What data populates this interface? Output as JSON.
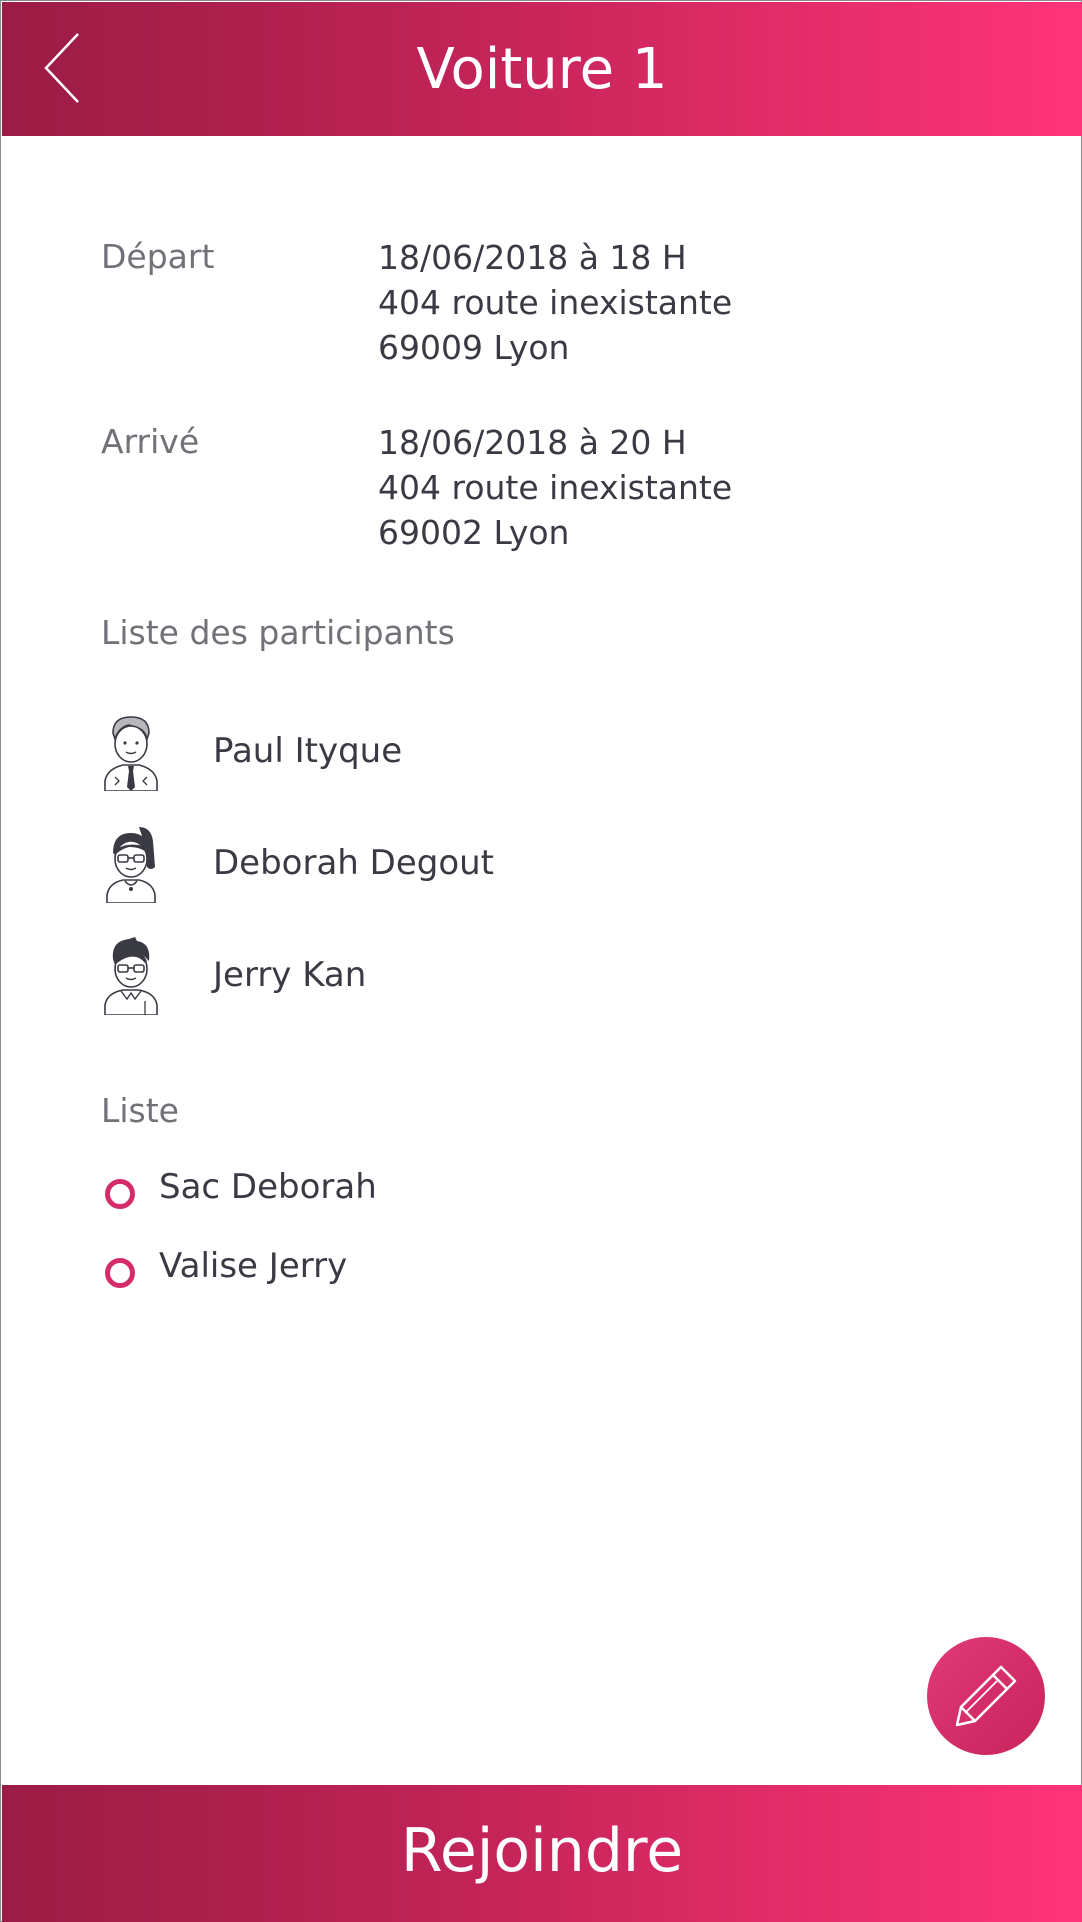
{
  "header": {
    "title": "Voiture 1"
  },
  "trip": {
    "departure": {
      "label": "Départ",
      "datetime": "18/06/2018 à 18 H",
      "street": "404 route inexistante",
      "city": "69009 Lyon"
    },
    "arrival": {
      "label": "Arrivé",
      "datetime": "18/06/2018 à 20 H",
      "street": "404 route inexistante",
      "city": "69002 Lyon"
    }
  },
  "participants": {
    "title": "Liste des participants",
    "items": [
      {
        "name": "Paul Ityque",
        "avatar": "man-tie-avatar-icon"
      },
      {
        "name": "Deborah Degout",
        "avatar": "woman-glasses-avatar-icon"
      },
      {
        "name": "Jerry Kan",
        "avatar": "man-glasses-avatar-icon"
      }
    ]
  },
  "luggage": {
    "title": "Liste",
    "items": [
      {
        "label": "Sac Deborah"
      },
      {
        "label": "Valise Jerry"
      }
    ]
  },
  "footer": {
    "join_label": "Rejoindre"
  },
  "colors": {
    "accent": "#d42c68",
    "gradient_start": "#9a1c45",
    "gradient_end": "#ff3478"
  }
}
